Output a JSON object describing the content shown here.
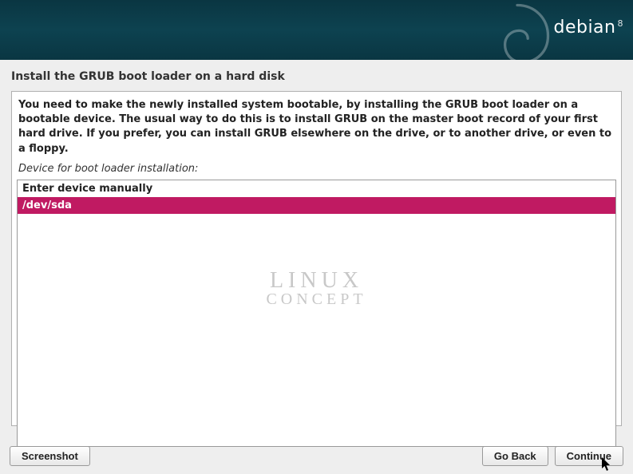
{
  "brand": {
    "name": "debian",
    "version": "8"
  },
  "page_title": "Install the GRUB boot loader on a hard disk",
  "description": "You need to make the newly installed system bootable, by installing the GRUB boot loader on a bootable device. The usual way to do this is to install GRUB on the master boot record of your first hard drive. If you prefer, you can install GRUB elsewhere on the drive, or to another drive, or even to a floppy.",
  "field_label": "Device for boot loader installation:",
  "devices": [
    {
      "label": "Enter device manually",
      "selected": false
    },
    {
      "label": "/dev/sda",
      "selected": true
    }
  ],
  "watermark": {
    "line1": "LINUX",
    "line2": "CONCEPT"
  },
  "buttons": {
    "screenshot": "Screenshot",
    "go_back": "Go Back",
    "continue": "Continue"
  }
}
